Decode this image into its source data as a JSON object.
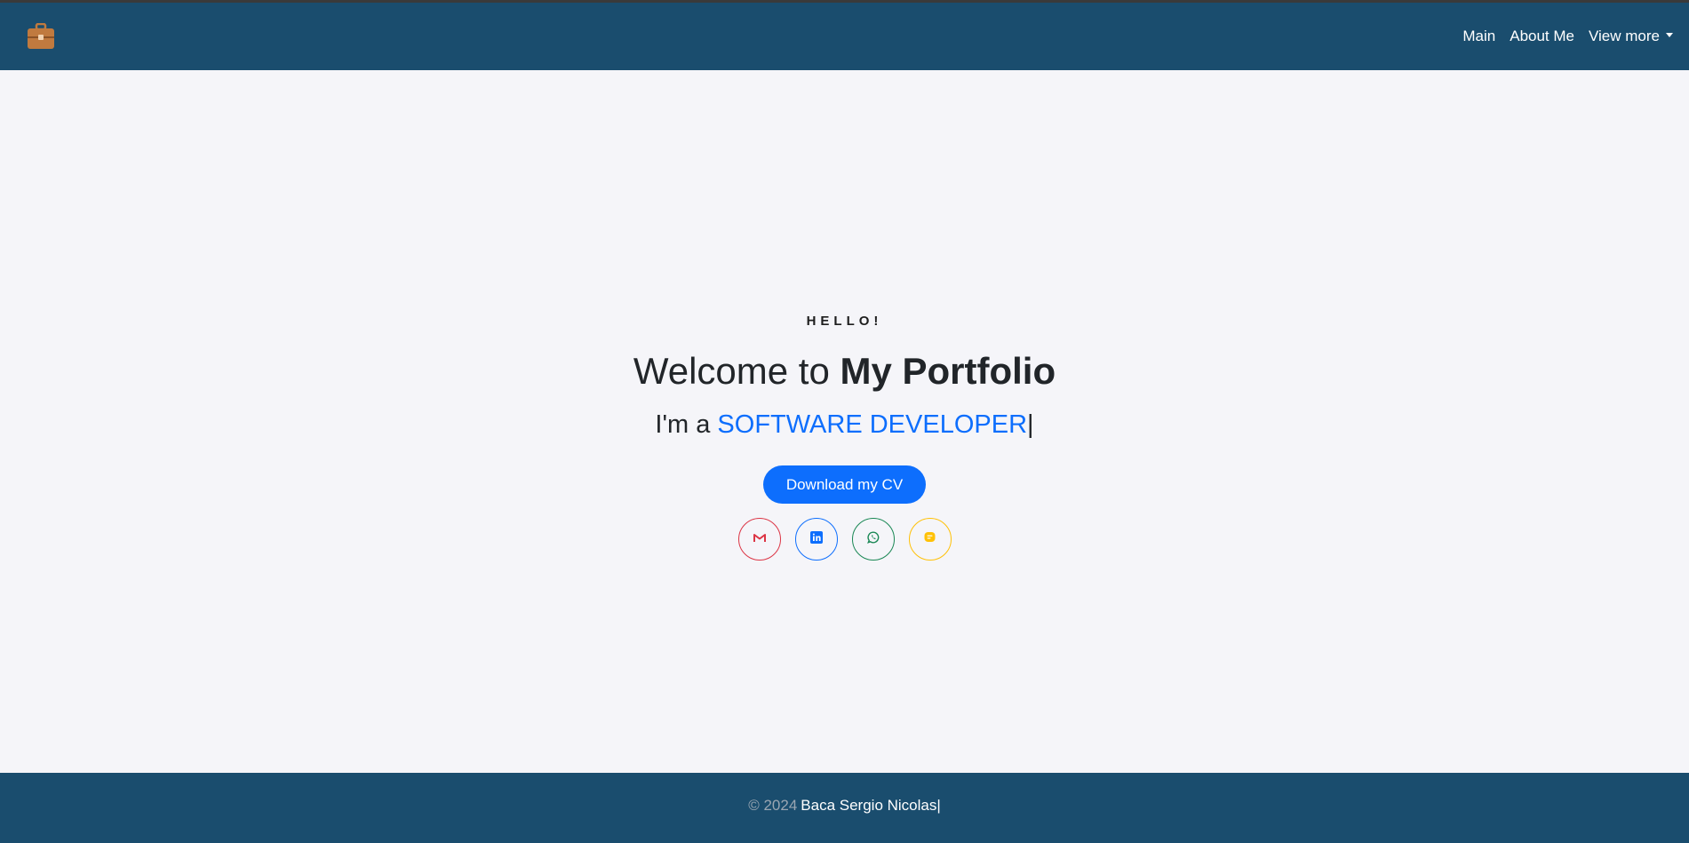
{
  "colors": {
    "navbar_bg": "#1a4d6e",
    "page_bg": "#f5f5f9",
    "accent": "#0d6efd",
    "brand_icon": "#c07a3f",
    "gmail": "#dc3545",
    "linkedin": "#0d6efd",
    "whatsapp": "#198754",
    "other_social": "#ffc107"
  },
  "navbar": {
    "brand_icon": "briefcase-icon",
    "links": [
      {
        "label": "Main"
      },
      {
        "label": "About Me"
      },
      {
        "label": "View more",
        "dropdown": true
      }
    ]
  },
  "hero": {
    "greeting": "HELLO!",
    "title_prefix": "Welcome to ",
    "title_bold": "My Portfolio",
    "subtitle_prefix": "I'm a ",
    "role": "SOFTWARE DEVELOPER",
    "typing_cursor": "|",
    "cv_button": "Download my CV",
    "socials": [
      {
        "icon": "gmail-icon"
      },
      {
        "icon": "linkedin-icon"
      },
      {
        "icon": "whatsapp-icon"
      },
      {
        "icon": "message-icon"
      }
    ]
  },
  "footer": {
    "copyright": "© 2024",
    "author": "Baca Sergio Nicolas",
    "typing_cursor": "|"
  }
}
